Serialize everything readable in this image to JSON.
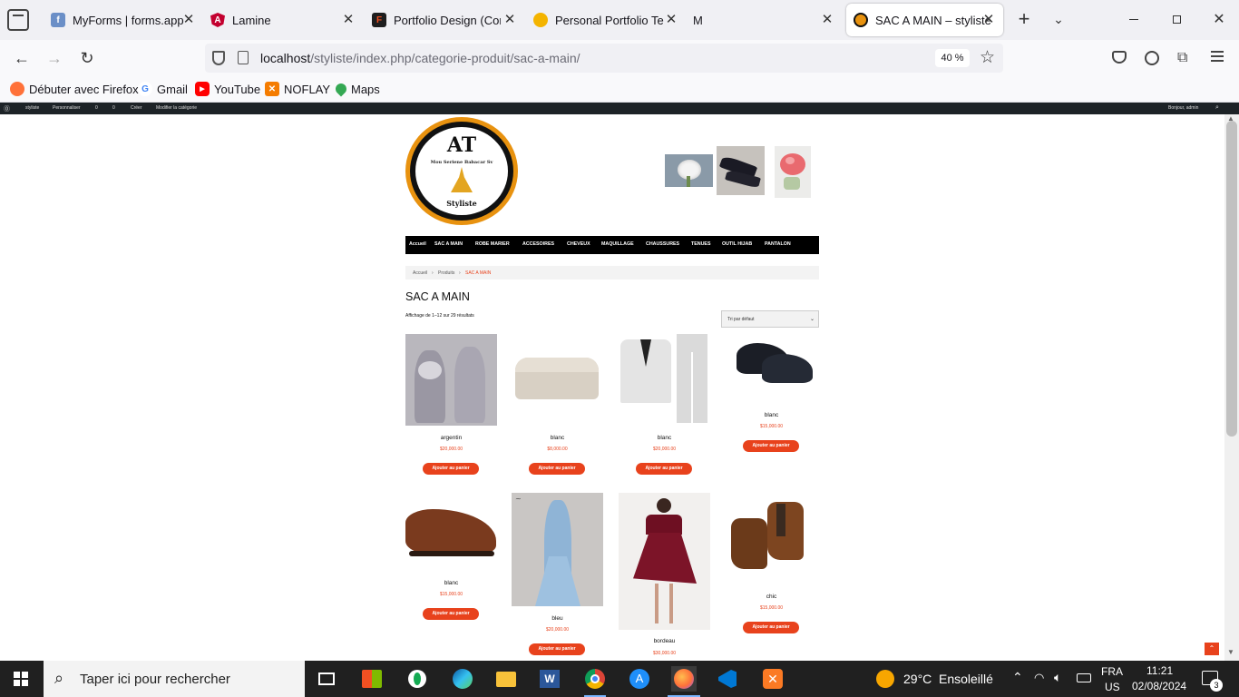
{
  "browser": {
    "tabs": [
      {
        "title": "MyForms | forms.app",
        "icon": "forms-app-icon",
        "color": "#6b8fc7"
      },
      {
        "title": "Lamine",
        "icon": "angular-icon",
        "color": "#c3002f"
      },
      {
        "title": "Portfolio Design (Com",
        "icon": "figma-icon",
        "color": "#1e1e1e"
      },
      {
        "title": "Personal Portfolio Tem",
        "icon": "palette-icon",
        "color": "#f4b400"
      },
      {
        "title": "M",
        "icon": "gmail-icon",
        "color": "#ffffff"
      },
      {
        "title": "SAC A MAIN – styliste",
        "icon": "site-logo-icon",
        "color": "#e8920f",
        "active": true
      }
    ],
    "url_host": "localhost",
    "url_path": "/styliste/index.php/categorie-produit/sac-a-main/",
    "zoom": "40 %",
    "bookmarks": [
      {
        "label": "Débuter avec Firefox",
        "icon": "firefox-icon",
        "color": "#ff7139"
      },
      {
        "label": "Gmail",
        "icon": "google-icon",
        "color": "#4285f4"
      },
      {
        "label": "YouTube",
        "icon": "youtube-icon",
        "color": "#ff0000"
      },
      {
        "label": "NOFLAY",
        "icon": "noflay-icon",
        "color": "#f57c00"
      },
      {
        "label": "Maps",
        "icon": "maps-icon",
        "color": "#34a853"
      }
    ]
  },
  "adminbar": {
    "site": "styliste",
    "customize": "Personnaliser",
    "updates": "0",
    "comments": "0",
    "new": "Créer",
    "edit": "Modifier la catégorie",
    "greeting": "Bonjour, admin"
  },
  "site": {
    "logo_initials": "AT",
    "logo_tagline": "Mou Seriene Babacar Sv",
    "logo_name": "Styliste",
    "menu": [
      "Accueil",
      "SAC A MAIN",
      "ROBE MARIER",
      "ACCESOIRES",
      "CHEVEUX",
      "MAQUILLAGE",
      "CHAUSSURES",
      "TENUES",
      "OUTIL HIJAB",
      "PANTALON"
    ],
    "breadcrumb": [
      "Accueil",
      "Produits",
      "SAC A MAIN"
    ],
    "page_title": "SAC A MAIN",
    "result_count": "Affichage de 1–12 sur 29 résultats",
    "orderby": "Tri par défaut",
    "add_to_cart": "Ajouter au panier",
    "products": [
      {
        "name": "argentin",
        "price": "$20,000.00"
      },
      {
        "name": "blanc",
        "price": "$8,000.00"
      },
      {
        "name": "blanc",
        "price": "$20,000.00"
      },
      {
        "name": "blanc",
        "price": "$15,000.00"
      },
      {
        "name": "blanc",
        "price": "$15,000.00"
      },
      {
        "name": "bleu",
        "price": "$20,000.00"
      },
      {
        "name": "bordeau",
        "price": "$30,000.00"
      },
      {
        "name": "chic",
        "price": "$15,000.00"
      }
    ],
    "accent_color": "#e8421c"
  },
  "taskbar": {
    "search_placeholder": "Taper ici pour rechercher",
    "weather_temp": "29°C",
    "weather_desc": "Ensoleillé",
    "lang": "FRA",
    "region": "US",
    "time": "11:21",
    "date": "02/08/2024",
    "notifications": "3"
  }
}
